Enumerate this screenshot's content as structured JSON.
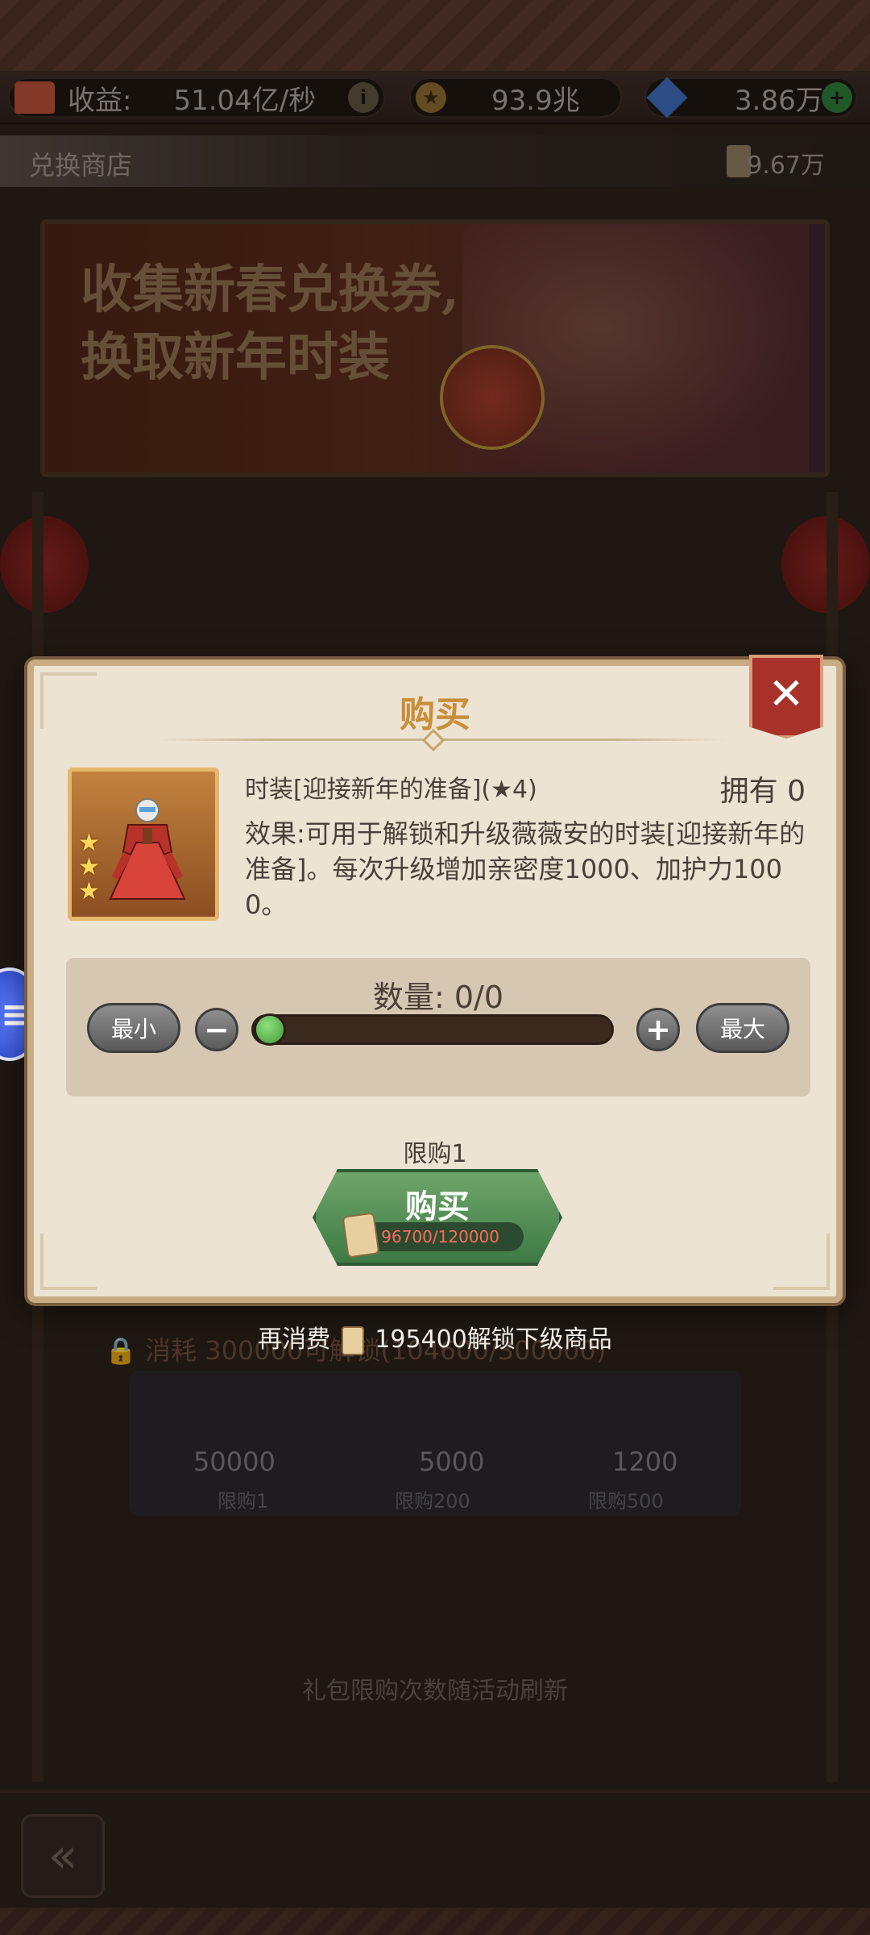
{
  "resources": {
    "income_label": "收益:",
    "income_value": "51.04亿/秒",
    "gold_value": "93.9兆",
    "gem_value": "3.86万"
  },
  "shop": {
    "title": "兑换商店",
    "ticket_count": "9.67万"
  },
  "banner": {
    "line1": "收集新春兑换券,",
    "line2": "换取新年时装"
  },
  "background": {
    "lock_text": "消耗",
    "lock_detail": "300000可解锁(104600/300000)",
    "items": [
      {
        "price": "50000",
        "limit": "限购1"
      },
      {
        "price": "5000",
        "limit": "限购200"
      },
      {
        "price": "1200",
        "limit": "限购500"
      }
    ],
    "note": "礼包限购次数随活动刷新"
  },
  "dialog": {
    "title": "购买",
    "close_label": "✕",
    "item_name": "时装[迎接新年的准备](★4)",
    "star_rating": 4,
    "owned": "拥有 0",
    "description": "效果:可用于解锁和升级薇薇安的时装[迎接新年的准备]。每次升级增加亲密度1000、加护力1000。",
    "qty_label": "数量: 0/0",
    "min_label": "最小",
    "max_label": "最大",
    "minus_label": "−",
    "plus_label": "+",
    "slider_fraction": 0,
    "limit_text": "限购1",
    "buy_label": "购买",
    "cost_text": "96700/120000"
  },
  "unlock_hint": {
    "prefix": "再消费",
    "suffix": "195400解锁下级商品"
  },
  "colors": {
    "accent_orange": "#c98e3a",
    "buy_green": "#3e7a44",
    "cost_red": "#ff6a5a",
    "close_red": "#a8322a"
  },
  "icons": {
    "house": "house-icon",
    "info": "info-icon",
    "gold": "coin-icon",
    "gem": "gem-icon",
    "add": "plus-icon",
    "ticket": "ticket-icon",
    "back": "back-arrow-icon",
    "side": "side-menu-icon"
  }
}
